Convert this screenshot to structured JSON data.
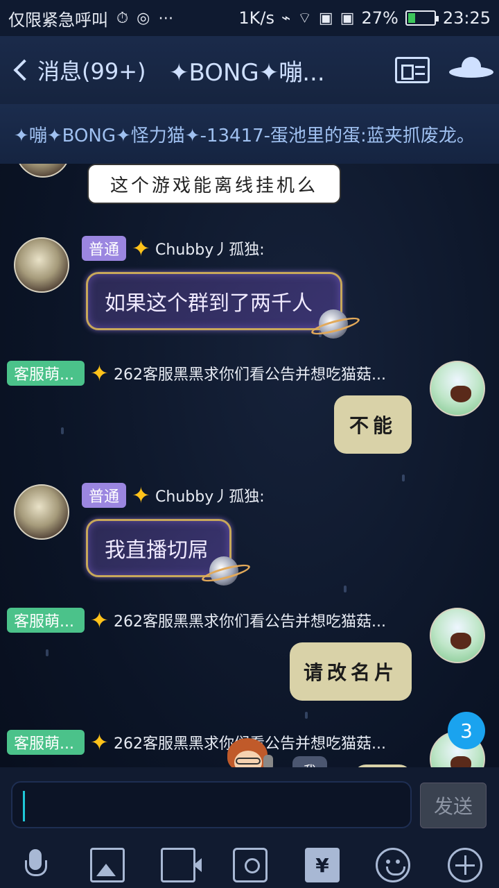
{
  "status_bar": {
    "emergency_text": "仅限紧急呼叫",
    "net_speed": "1K/s",
    "battery_percent": "27%",
    "battery_level": 0.27,
    "time": "23:25"
  },
  "header": {
    "back_label": "消息(99+)",
    "title": "✦BONG✦嘣...",
    "profile_card_icon": "profile-card-icon",
    "ufo_icon": "ufo-icon"
  },
  "notice": {
    "text": "✦嘣✦BONG✦怪力猫✦-13417-蛋池里的蛋:蓝夹抓废龙。"
  },
  "messages": [
    {
      "type": "left-white",
      "text": "这个游戏能离线挂机么"
    },
    {
      "type": "left-purple",
      "badge": "普通",
      "sender": "Chubby丿孤独:",
      "text": "如果这个群到了两千人"
    },
    {
      "type": "right-cream",
      "badge": "客服萌...",
      "sender": "262客服黑黑求你们看公告并想吃猫菇...",
      "text": "不能"
    },
    {
      "type": "left-purple",
      "badge": "普通",
      "sender": "Chubby丿孤独:",
      "text": "我直播切屌"
    },
    {
      "type": "right-cream",
      "badge": "客服萌...",
      "sender": "262客服黑黑求你们看公告并想吃猫菇...",
      "text": "请改名片"
    },
    {
      "type": "right-partial",
      "badge": "客服萌...",
      "sender": "262客服黑黑求你们看公告并想吃猫菇..."
    }
  ],
  "unread_count": "3",
  "me_tag": "我",
  "input": {
    "value": "",
    "send_label": "发送"
  },
  "toolbar": {
    "red_packet_symbol": "¥",
    "icons": [
      "mic-icon",
      "image-icon",
      "video-icon",
      "camera-icon",
      "red-packet-icon",
      "emoji-icon",
      "plus-icon"
    ]
  },
  "colors": {
    "badge_normal": "#9b86e0",
    "badge_service": "#4bc28a",
    "unread": "#1aa3ef"
  }
}
